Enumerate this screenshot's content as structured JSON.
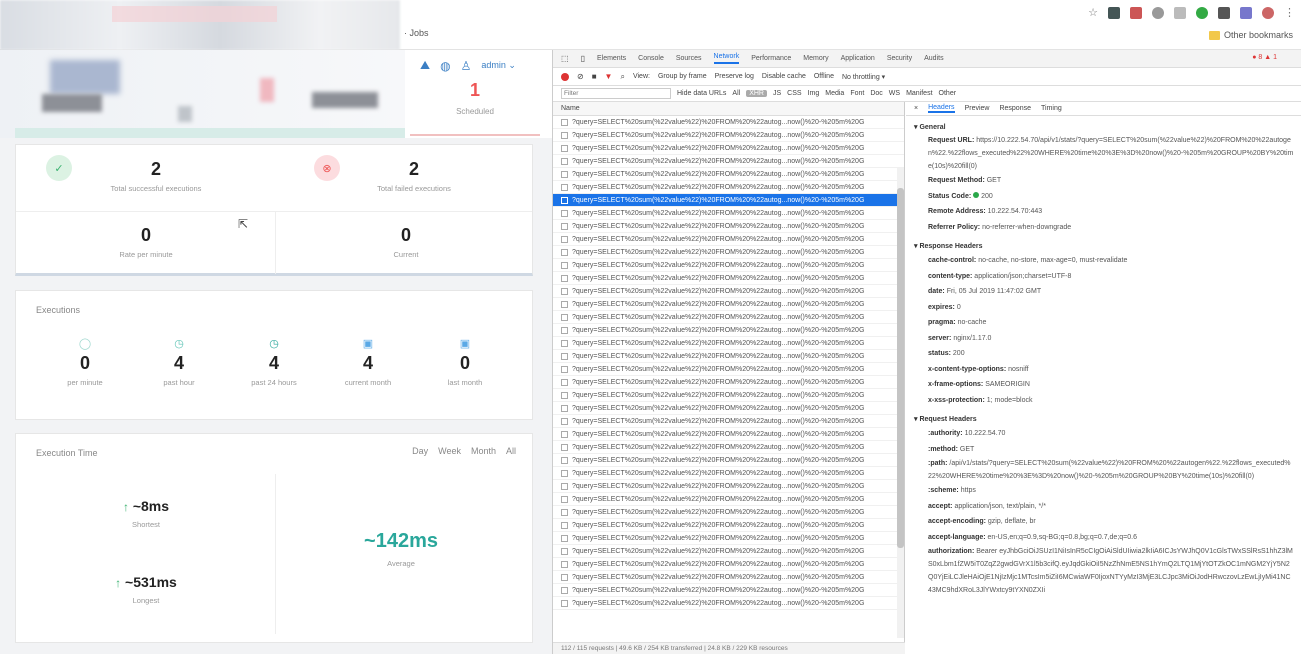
{
  "browser": {
    "url_fragment": "· Jobs",
    "bookmark_label": "Other bookmarks"
  },
  "app": {
    "user": "admin ⌄",
    "scheduled": {
      "value": "1",
      "label": "Scheduled"
    },
    "summary": {
      "successful": {
        "value": "2",
        "label": "Total successful executions"
      },
      "failed": {
        "value": "2",
        "label": "Total failed executions"
      },
      "rate": {
        "value": "0",
        "label": "Rate per minute"
      },
      "current": {
        "value": "0",
        "label": "Current"
      }
    },
    "executions": {
      "title": "Executions",
      "items": [
        {
          "value": "0",
          "label": "per minute"
        },
        {
          "value": "4",
          "label": "past hour"
        },
        {
          "value": "4",
          "label": "past 24 hours"
        },
        {
          "value": "4",
          "label": "current month"
        },
        {
          "value": "0",
          "label": "last month"
        }
      ]
    },
    "execution_time": {
      "title": "Execution Time",
      "tabs": [
        "Day",
        "Week",
        "Month",
        "All"
      ],
      "shortest": {
        "value": "~8ms",
        "label": "Shortest"
      },
      "longest": {
        "value": "~531ms",
        "label": "Longest"
      },
      "average": {
        "value": "~142ms",
        "label": "Average"
      }
    }
  },
  "devtools": {
    "tabs": [
      "Elements",
      "Console",
      "Sources",
      "Network",
      "Performance",
      "Memory",
      "Application",
      "Security",
      "Audits"
    ],
    "active_tab": "Network",
    "error_badge": "● 8 ▲ 1",
    "toolbar": [
      "View:",
      "Group by frame",
      "Preserve log",
      "Disable cache",
      "Offline",
      "No throttling ▾"
    ],
    "filter_placeholder": "Filter",
    "filter_types": [
      "Hide data URLs",
      "All",
      "XHR",
      "JS",
      "CSS",
      "Img",
      "Media",
      "Font",
      "Doc",
      "WS",
      "Manifest",
      "Other"
    ],
    "list_header": "Name",
    "request_name": "?query=SELECT%20sum(%22value%22)%20FROM%20%22autog...now()%20-%205m%20G",
    "status_bar": "112 / 115 requests | 49.6 KB / 254 KB transferred | 24.8 KB / 229 KB resources",
    "detail_tabs": [
      "×",
      "Headers",
      "Preview",
      "Response",
      "Timing"
    ],
    "general": {
      "title": "▾ General",
      "request_url_label": "Request URL:",
      "request_url": "https://10.222.54.70/api/v1/stats/?query=SELECT%20sum(%22value%22)%20FROM%20%22autogen%22.%22flows_executed%22%20WHERE%20time%20%3E%3D%20now()%20-%205m%20GROUP%20BY%20time(10s)%20fill(0)",
      "method_label": "Request Method:",
      "method": "GET",
      "status_label": "Status Code:",
      "status": "200",
      "remote_label": "Remote Address:",
      "remote": "10.222.54.70:443",
      "referrer_label": "Referrer Policy:",
      "referrer": "no-referrer-when-downgrade"
    },
    "response_headers": {
      "title": "▾ Response Headers",
      "items": [
        {
          "k": "cache-control:",
          "v": "no-cache, no-store, max-age=0, must-revalidate"
        },
        {
          "k": "content-type:",
          "v": "application/json;charset=UTF-8"
        },
        {
          "k": "date:",
          "v": "Fri, 05 Jul 2019 11:47:02 GMT"
        },
        {
          "k": "expires:",
          "v": "0"
        },
        {
          "k": "pragma:",
          "v": "no-cache"
        },
        {
          "k": "server:",
          "v": "nginx/1.17.0"
        },
        {
          "k": "status:",
          "v": "200"
        },
        {
          "k": "x-content-type-options:",
          "v": "nosniff"
        },
        {
          "k": "x-frame-options:",
          "v": "SAMEORIGIN"
        },
        {
          "k": "x-xss-protection:",
          "v": "1; mode=block"
        }
      ]
    },
    "request_headers": {
      "title": "▾ Request Headers",
      "authority_label": ":authority:",
      "authority": "10.222.54.70",
      "method_label": ":method:",
      "method": "GET",
      "path_label": ":path:",
      "path": "/api/v1/stats/?query=SELECT%20sum(%22value%22)%20FROM%20%22autogen%22.%22flows_executed%22%20WHERE%20time%20%3E%3D%20now()%20-%205m%20GROUP%20BY%20time(10s)%20fill(0)",
      "scheme_label": ":scheme:",
      "scheme": "https",
      "accept_label": "accept:",
      "accept": "application/json, text/plain, */*",
      "encoding_label": "accept-encoding:",
      "encoding": "gzip, deflate, br",
      "language_label": "accept-language:",
      "language": "en-US,en;q=0.9,sq-BG;q=0.8,bg;q=0.7,de;q=0.6",
      "auth_label": "authorization:",
      "auth": "Bearer eyJhbGciOiJSUzI1NiIsInR5cCIgOiAiSldUIiwia2lkIiA6ICJsYWJhQ0V1cGlsTWxSSlRsS1hhZ3lMS0xLbm1fZW5iT0ZqZ2gwdGVrX1l5b3cifQ.eyJqdGkiOiI5NzZhNmE5NS1hYmQ2LTQ1MjYtOTZkOC1mNGM2YjY5N2Q0YjEiLCJleHAiOjE1NjIzMjc1MTcsIm5iZiI6MCwiaWF0IjoxNTYyMzI3MjE3LCJpc3MiOiJodHRwczovLzEwLjIyMi41NC43MC9hdXRoL3JlYWxtcy9tYXN0ZXIi"
    }
  }
}
